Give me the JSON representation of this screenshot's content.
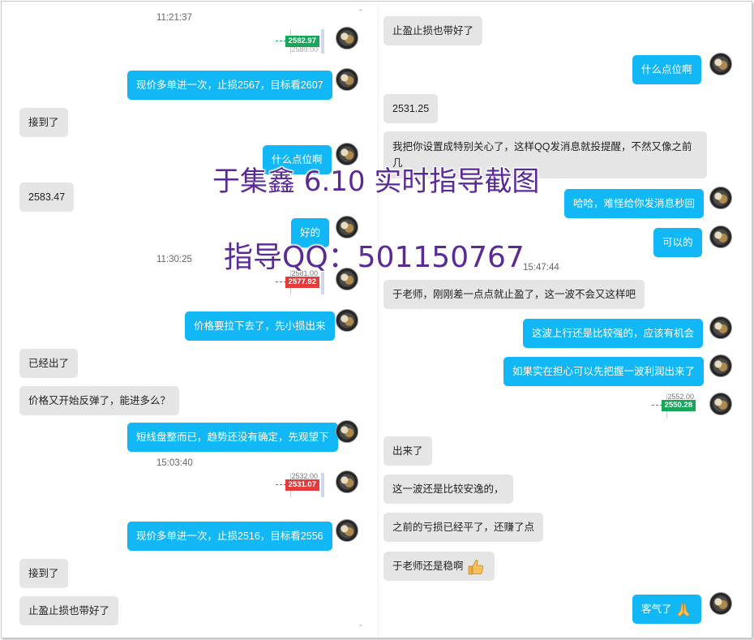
{
  "watermark": {
    "line1": "于集鑫 6.10 实时指导截图",
    "line2": "指导QQ：501150767"
  },
  "left": {
    "timestamps": [
      "11:21:37",
      "11:30:25",
      "15:03:40"
    ],
    "messages": [
      {
        "type": "price",
        "value": "2582.97",
        "ghost": "2589.00",
        "color": "green"
      },
      {
        "type": "out",
        "text": "现价多单进一次，止损2567，目标看2607"
      },
      {
        "type": "in",
        "text": "接到了"
      },
      {
        "type": "out",
        "text": "什么点位啊"
      },
      {
        "type": "in",
        "text": "2583.47"
      },
      {
        "type": "out",
        "text": "好的"
      },
      {
        "type": "price",
        "value": "2577.92",
        "ghost": "2581.00",
        "color": "red"
      },
      {
        "type": "out",
        "text": "价格要拉下去了，先小损出来"
      },
      {
        "type": "in",
        "text": "已经出了"
      },
      {
        "type": "in",
        "text": "价格又开始反弹了，能进多么？"
      },
      {
        "type": "out",
        "text": "短线盘整而已，趋势还没有确定，先观望下"
      },
      {
        "type": "price",
        "value": "2531.07",
        "ghost": "2532.00",
        "color": "red"
      },
      {
        "type": "out",
        "text": "现价多单进一次，止损2516，目标看2556"
      },
      {
        "type": "in",
        "text": "接到了"
      },
      {
        "type": "in",
        "text": "止盈止损也带好了"
      }
    ]
  },
  "right": {
    "timestamps": [
      "15:47:44"
    ],
    "messages": [
      {
        "type": "in",
        "text": "止盈止损也带好了"
      },
      {
        "type": "out",
        "text": "什么点位啊"
      },
      {
        "type": "in",
        "text": "2531.25"
      },
      {
        "type": "in",
        "text": "我把你设置成特别关心了，这样QQ发消息就投提醒，不然又像之前几"
      },
      {
        "type": "out",
        "text": "哈哈，难怪给你发消息秒回"
      },
      {
        "type": "out",
        "text": "可以的"
      },
      {
        "type": "in",
        "text": "于老师，刚刚差一点点就止盈了，这一波不会又这样吧"
      },
      {
        "type": "out",
        "text": "这波上行还是比较强的，应该有机会"
      },
      {
        "type": "out",
        "text": "如果实在担心可以先把握一波利润出来了"
      },
      {
        "type": "price",
        "value": "2550.28",
        "ghost": "2552.00",
        "color": "green"
      },
      {
        "type": "in",
        "text": "出来了"
      },
      {
        "type": "in",
        "text": "这一波还是比较安逸的，"
      },
      {
        "type": "in",
        "text": "之前的亏损已经平了，还赚了点"
      },
      {
        "type": "in",
        "text": "于老师还是稳啊"
      },
      {
        "type": "out",
        "text": "客气了"
      }
    ]
  },
  "icons": {
    "thumbs_up": "thumbs-up-emoji",
    "pray": "pray-emoji",
    "avatar": "avatar-image"
  },
  "colors": {
    "out_bubble": "#12b7f5",
    "in_bubble": "#e5e5e5",
    "watermark": "#5a2a96",
    "price_up": "#17a65a",
    "price_down": "#e23c3c"
  }
}
